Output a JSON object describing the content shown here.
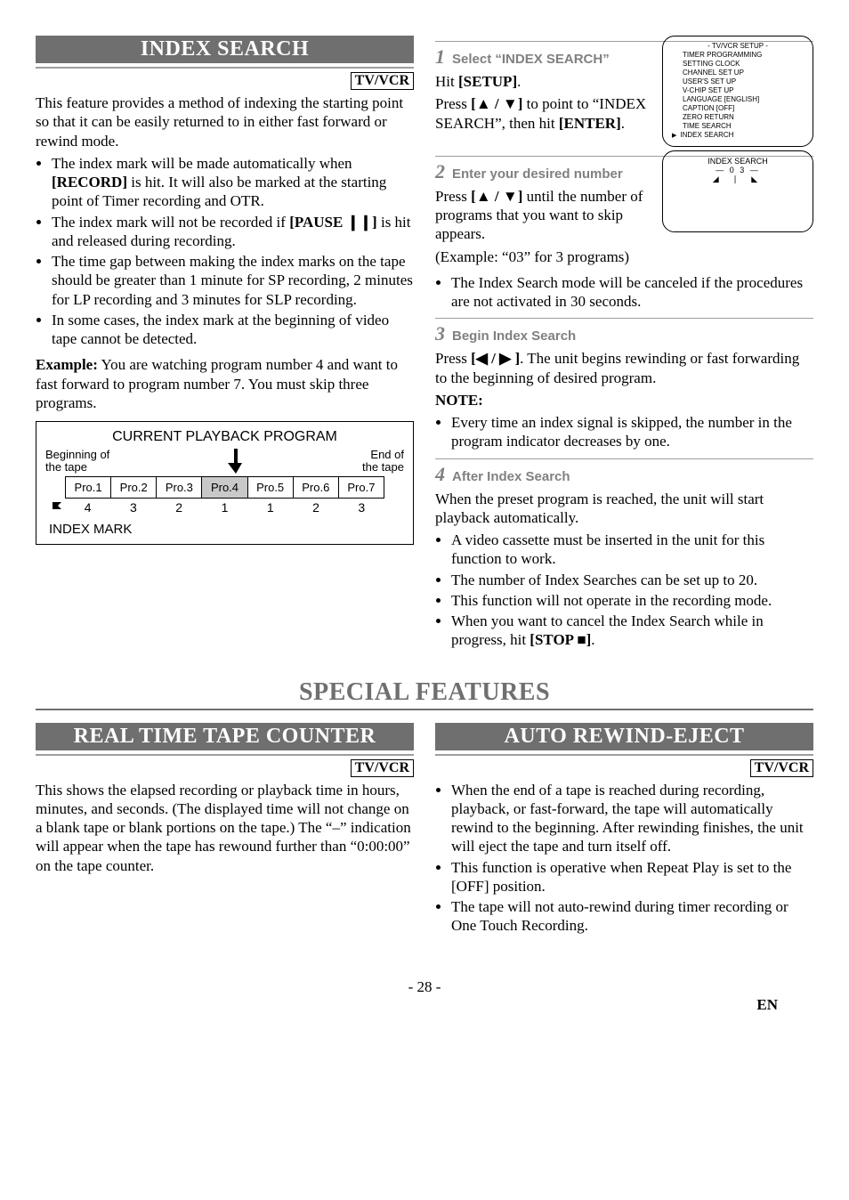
{
  "tvvcr_label": "TV/VCR",
  "index_search": {
    "title": "INDEX SEARCH",
    "intro": "This feature provides a method of indexing the starting point so that it can be easily returned to in either fast forward or rewind mode.",
    "b1_pre": "The index mark will be made automatically when ",
    "b1_bold": "[RECORD]",
    "b1_post": " is hit. It will also be marked at the starting point of Timer recording and OTR.",
    "b2_pre": "The index mark will not be recorded if ",
    "b2_bold": "[PAUSE ❙❙]",
    "b2_post": " is hit and released during recording.",
    "b3": "The time gap between making the index marks on the tape should be greater than 1 minute for SP recording, 2 minutes for LP recording and 3 minutes for SLP recording.",
    "b4": "In some cases, the index mark at the beginning of video tape cannot be detected.",
    "example_label": "Example:",
    "example_text": " You are watching program number 4 and want to fast forward to program number 7. You must skip three programs.",
    "playback": {
      "title": "CURRENT PLAYBACK PROGRAM",
      "begin": "Beginning of\nthe tape",
      "end": "End of\nthe tape",
      "cells": [
        "Pro.1",
        "Pro.2",
        "Pro.3",
        "Pro.4",
        "Pro.5",
        "Pro.6",
        "Pro.7"
      ],
      "nums": [
        "4",
        "3",
        "2",
        "1",
        "1",
        "2",
        "3"
      ],
      "mark": "INDEX MARK"
    }
  },
  "steps": {
    "s1": {
      "num": "1",
      "title": "Select “INDEX SEARCH”",
      "l1_pre": "Hit ",
      "l1_bold": "[SETUP]",
      "l1_post": ".",
      "l2_pre": "Press ",
      "l2_bold": "[▲ / ▼]",
      "l2_mid": " to point to “INDEX SEARCH”, then hit ",
      "l2_bold2": "[ENTER]",
      "l2_post": "."
    },
    "osd1": {
      "title": "- TV/VCR SETUP -",
      "items": [
        "TIMER PROGRAMMING",
        "SETTING CLOCK",
        "CHANNEL SET UP",
        "USER'S SET UP",
        "V-CHIP SET UP",
        "LANGUAGE   [ENGLISH]",
        "CAPTION   [OFF]",
        "ZERO RETURN",
        "TIME SEARCH",
        "INDEX SEARCH"
      ]
    },
    "s2": {
      "num": "2",
      "title": "Enter your desired number",
      "p1_pre": "Press ",
      "p1_bold": "[▲ / ▼]",
      "p1_post": " until the number of programs that you want to skip appears.",
      "p2": "(Example: “03” for 3 programs)",
      "b1": "The Index Search mode will be canceled if the procedures are not activated in 30 seconds."
    },
    "osd2": {
      "title": "INDEX SEARCH",
      "num": "— 0 3 —",
      "arrows": "◢ ❘ ◣"
    },
    "s3": {
      "num": "3",
      "title": "Begin Index Search",
      "p1_pre": "Press ",
      "p1_bold": "[◀ / ▶ ]",
      "p1_post": ". The unit begins rewinding or fast forwarding to the beginning of desired program.",
      "note_label": "NOTE:",
      "b1": "Every time an index signal is skipped, the number in the program indicator decreases by one."
    },
    "s4": {
      "num": "4",
      "title": "After Index Search",
      "p1": "When the preset program is reached, the unit will start playback automatically.",
      "b1": "A video cassette must be inserted in the unit for this function to work.",
      "b2": "The number of Index Searches can be set up to 20.",
      "b3": "This function will not operate in the recording mode.",
      "b4_pre": "When you want to cancel the Index Search while in progress, hit ",
      "b4_bold": "[STOP ■]",
      "b4_post": "."
    }
  },
  "special": {
    "title": "SPECIAL FEATURES"
  },
  "rttc": {
    "title": "REAL TIME TAPE COUNTER",
    "p1": "This shows the elapsed recording or playback time in hours, minutes, and seconds. (The displayed time will not change on a blank tape or blank portions on the tape.) The “–” indication will appear when the tape has rewound further than “0:00:00” on the tape counter."
  },
  "are": {
    "title": "AUTO REWIND-EJECT",
    "b1": "When the end of a tape is reached during recording, playback, or fast-forward, the tape will automatically rewind to the beginning. After rewinding finishes, the unit will eject the tape and turn itself off.",
    "b2": "This function is operative when Repeat Play is set to the [OFF] position.",
    "b3": "The tape will not auto-rewind during timer recording or One Touch Recording."
  },
  "footer": {
    "page": "- 28 -",
    "en": "EN"
  }
}
